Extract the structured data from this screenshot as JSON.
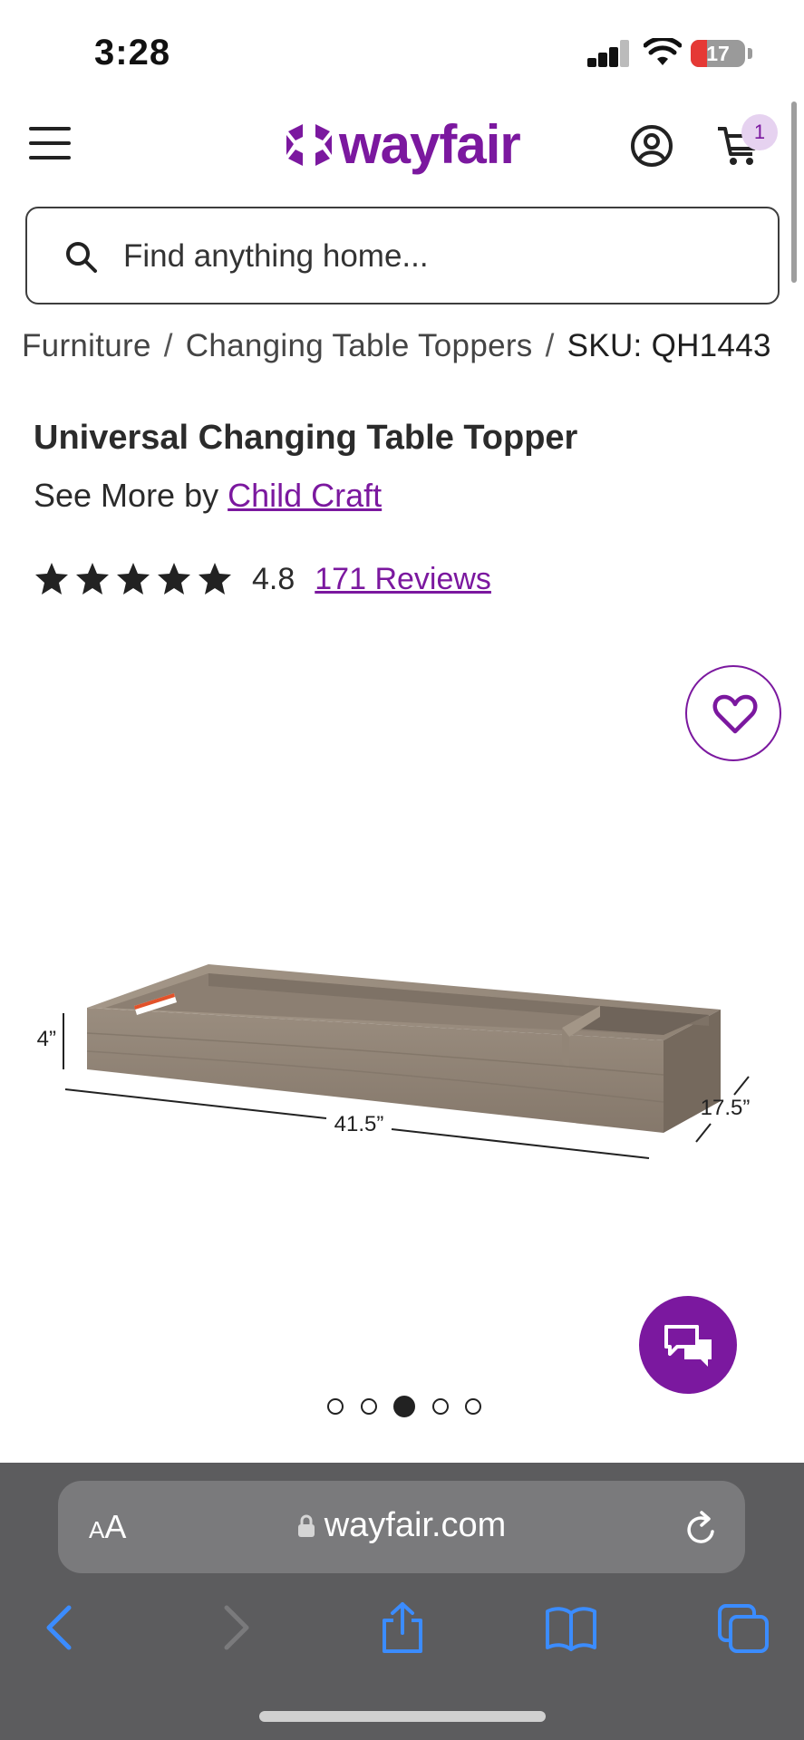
{
  "status_bar": {
    "time": "3:28",
    "battery_level": "17"
  },
  "header": {
    "logo_text": "wayfair",
    "cart_count": "1",
    "brand_color": "#7b189f"
  },
  "search": {
    "placeholder": "Find anything home..."
  },
  "breadcrumb": {
    "items": [
      "Furniture",
      "Changing Table Toppers"
    ],
    "separator": "/",
    "sku": "SKU: QH1443"
  },
  "product": {
    "title": "Universal Changing Table Topper",
    "see_more_prefix": "See More by",
    "brand": "Child Craft",
    "rating_value": "4.8",
    "rating_stars": 5,
    "reviews_label": "171 Reviews",
    "image_dimensions": {
      "height": "4”",
      "length": "41.5”",
      "depth": "17.5”"
    },
    "carousel": {
      "total": 5,
      "active_index": 2
    }
  },
  "browser": {
    "text_size_label_small": "A",
    "text_size_label_large": "A",
    "url": "wayfair.com"
  },
  "icons": {
    "menu": "hamburger-icon",
    "account": "user-circle-icon",
    "cart": "cart-icon",
    "search": "search-icon",
    "favorite": "heart-icon",
    "chat": "chat-icon",
    "lock": "lock-icon",
    "reload": "reload-icon",
    "back": "chevron-left-icon",
    "forward": "chevron-right-icon",
    "share": "share-icon",
    "bookmarks": "book-icon",
    "tabs": "tabs-icon"
  }
}
